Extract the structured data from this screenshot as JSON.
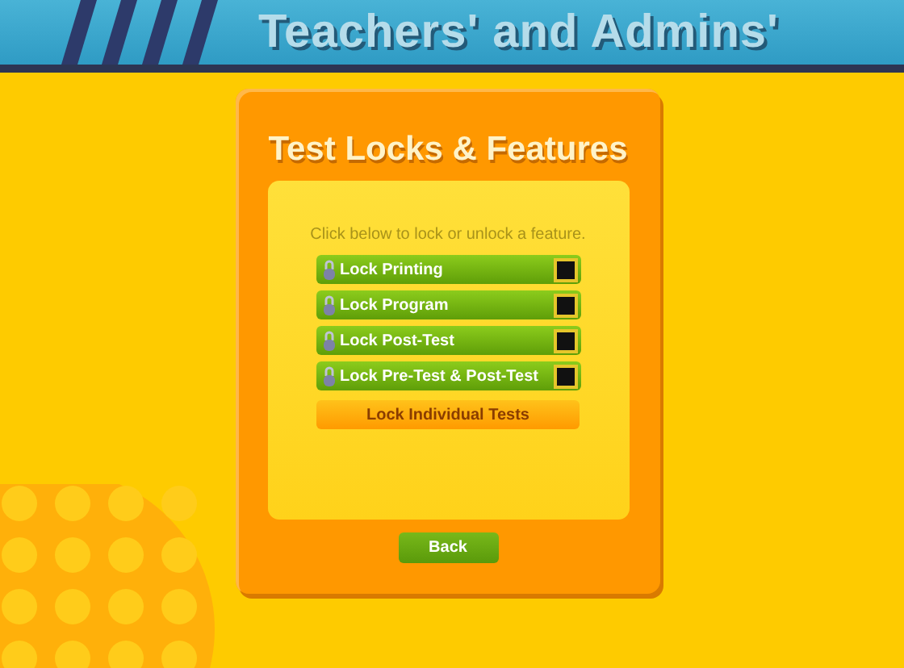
{
  "header": {
    "title": "Teachers' and Admins'"
  },
  "panel": {
    "title": "Test Locks & Features",
    "instruction": "Click below to lock or unlock a feature.",
    "locks": [
      {
        "label": "Lock Printing",
        "checked": false
      },
      {
        "label": "Lock Program",
        "checked": false
      },
      {
        "label": "Lock Post-Test",
        "checked": false
      },
      {
        "label": "Lock Pre-Test & Post-Test",
        "checked": false
      }
    ],
    "individual_button": "Lock Individual Tests",
    "back_button": "Back"
  }
}
